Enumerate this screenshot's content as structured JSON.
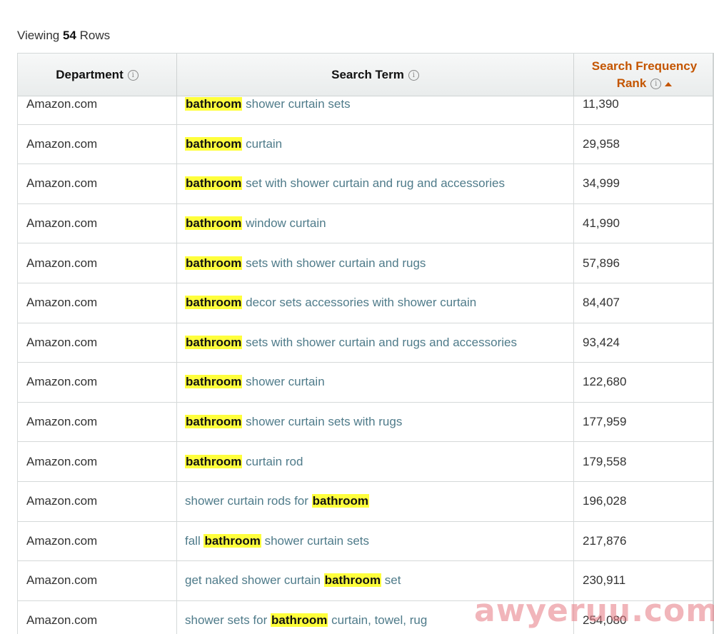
{
  "viewing": {
    "prefix": "Viewing",
    "count": "54",
    "suffix": "Rows"
  },
  "columns": {
    "department": "Department",
    "search_term": "Search Term",
    "rank_line1": "Search Frequency",
    "rank_line2": "Rank"
  },
  "rows": [
    {
      "department": "Amazon.com",
      "before": "",
      "highlight": "bathroom",
      "after": " shower curtain sets",
      "rank": "11,390"
    },
    {
      "department": "Amazon.com",
      "before": "",
      "highlight": "bathroom",
      "after": " curtain",
      "rank": "29,958"
    },
    {
      "department": "Amazon.com",
      "before": "",
      "highlight": "bathroom",
      "after": " set with shower curtain and rug and accessories",
      "rank": "34,999"
    },
    {
      "department": "Amazon.com",
      "before": "",
      "highlight": "bathroom",
      "after": " window curtain",
      "rank": "41,990"
    },
    {
      "department": "Amazon.com",
      "before": "",
      "highlight": "bathroom",
      "after": " sets with shower curtain and rugs",
      "rank": "57,896"
    },
    {
      "department": "Amazon.com",
      "before": "",
      "highlight": "bathroom",
      "after": " decor sets accessories with shower curtain",
      "rank": "84,407"
    },
    {
      "department": "Amazon.com",
      "before": "",
      "highlight": "bathroom",
      "after": " sets with shower curtain and rugs and accessories",
      "rank": "93,424"
    },
    {
      "department": "Amazon.com",
      "before": "",
      "highlight": "bathroom",
      "after": " shower curtain",
      "rank": "122,680"
    },
    {
      "department": "Amazon.com",
      "before": "",
      "highlight": "bathroom",
      "after": " shower curtain sets with rugs",
      "rank": "177,959"
    },
    {
      "department": "Amazon.com",
      "before": "",
      "highlight": "bathroom",
      "after": " curtain rod",
      "rank": "179,558"
    },
    {
      "department": "Amazon.com",
      "before": "shower curtain rods for ",
      "highlight": "bathroom",
      "after": "",
      "rank": "196,028"
    },
    {
      "department": "Amazon.com",
      "before": "fall ",
      "highlight": "bathroom",
      "after": " shower curtain sets",
      "rank": "217,876"
    },
    {
      "department": "Amazon.com",
      "before": "get naked shower curtain ",
      "highlight": "bathroom",
      "after": " set",
      "rank": "230,911"
    },
    {
      "department": "Amazon.com",
      "before": "shower sets for ",
      "highlight": "bathroom",
      "after": " curtain, towel, rug",
      "rank": "254,080"
    }
  ],
  "watermark": "awyeruu.com",
  "colors": {
    "highlight": "#ffff3c",
    "link": "#4f7b8a",
    "sort_header": "#c45500"
  },
  "icons": {
    "info": "info-circle-icon",
    "sort": "sort-ascending-icon"
  }
}
